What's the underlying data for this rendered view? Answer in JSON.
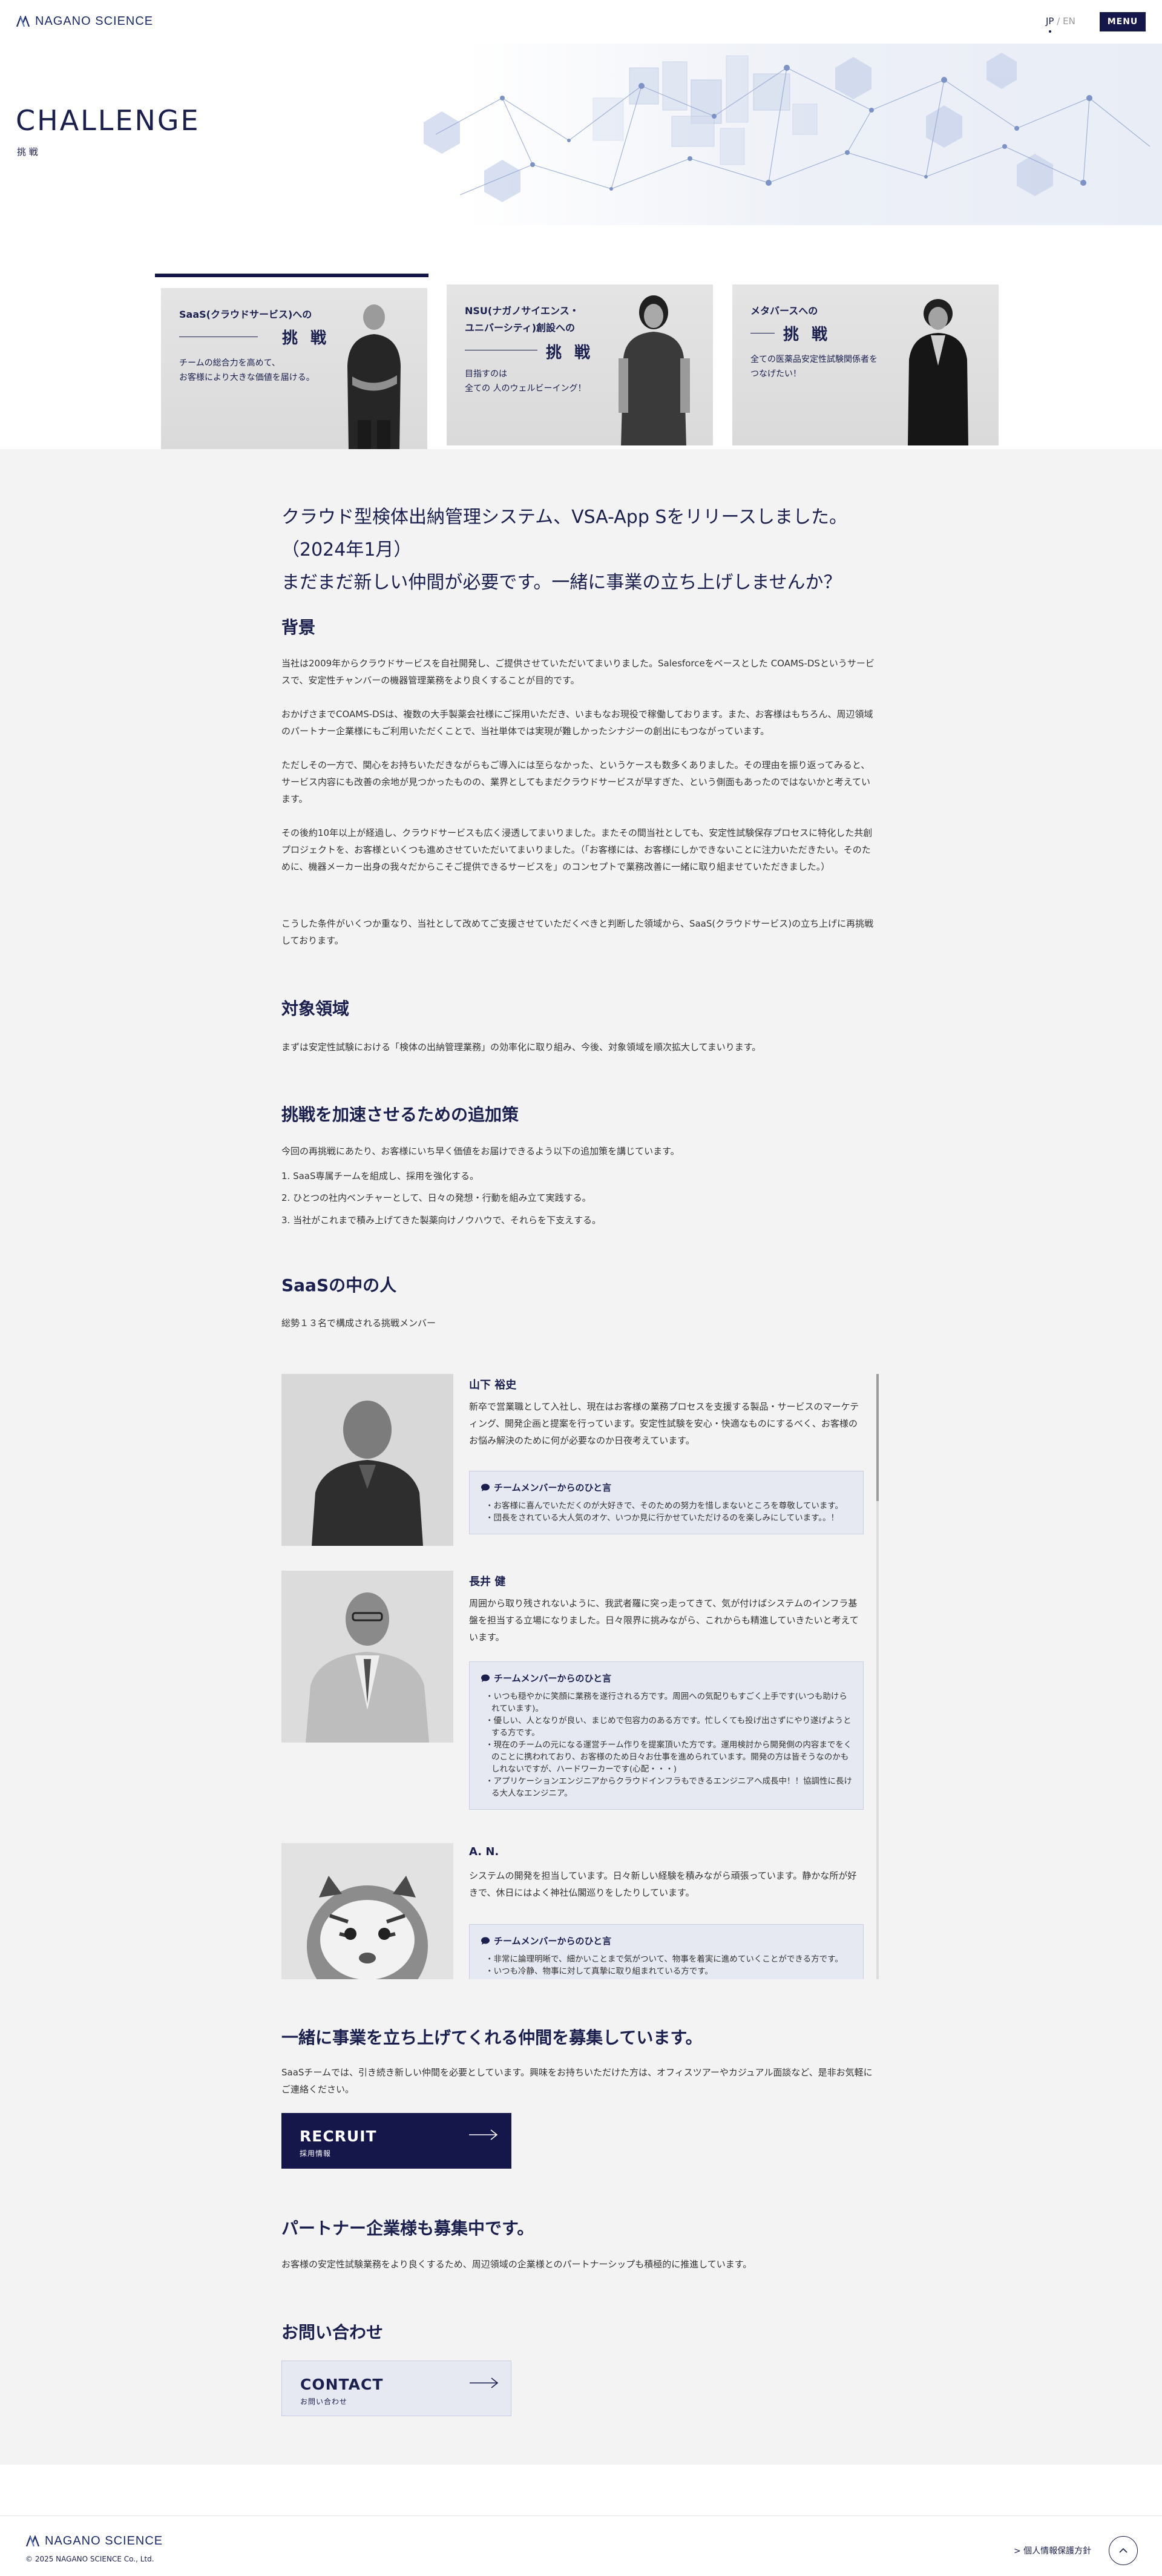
{
  "header": {
    "logo_text": "NAGANO SCIENCE",
    "lang_jp": "JP",
    "lang_sep": "/",
    "lang_en": "EN",
    "menu_label": "MENU"
  },
  "hero": {
    "title": "CHALLENGE",
    "subtitle": "挑 戦"
  },
  "tabs": [
    {
      "title_line1": "SaaS(クラウドサービス)への",
      "title_line2": "",
      "big": "挑 戦",
      "desc_line1": "チームの総合力を高めて、",
      "desc_line2": "お客様により大きな価値を届ける。",
      "active": true
    },
    {
      "title_line1": "NSU(ナガノサイエンス・",
      "title_line2": "ユニバーシティ)創設への",
      "big": "挑 戦",
      "desc_line1": "目指すのは",
      "desc_line2": "全ての 人のウェルビーイング！",
      "active": false
    },
    {
      "title_line1": "メタバースへの",
      "title_line2": "",
      "big": "挑 戦",
      "desc_line1": "全ての医薬品安定性試験関係者を",
      "desc_line2": "つなげたい！",
      "active": false
    }
  ],
  "lead": {
    "line1": "クラウド型検体出納管理システム、VSA-App Sをリリースしました。",
    "line2": "（2024年1月）",
    "line3": "まだまだ新しい仲間が必要です。一緒に事業の立ち上げしませんか？"
  },
  "background": {
    "heading": "背景",
    "p1": "当社は2009年からクラウドサービスを自社開発し、ご提供させていただいてまいりました。Salesforceをベースとした COAMS-DSというサービスで、安定性チャンバーの機器管理業務をより良くすることが目的です。",
    "p2": "おかげさまでCOAMS-DSは、複数の大手製薬会社様にご採用いただき、いまもなお現役で稼働しております。また、お客様はもちろん、周辺領域のパートナー企業様にもご利用いただくことで、当社単体では実現が難しかったシナジーの創出にもつながっています。",
    "p3": "ただしその一方で、関心をお持ちいただきながらもご導入には至らなかった、というケースも数多くありました。その理由を振り返ってみると、サービス内容にも改善の余地が見つかったものの、業界としてもまだクラウドサービスが早すぎた、という側面もあったのではないかと考えています。",
    "p4": "その後約10年以上が経過し、クラウドサービスも広く浸透してまいりました。またその間当社としても、安定性試験保存プロセスに特化した共創プロジェクトを、お客様といくつも進めさせていただいてまいりました。（「お客様には、お客様にしかできないことに注力いただきたい。そのために、機器メーカー出身の我々だからこそご提供できるサービスを」のコンセプトで業務改善に一緒に取り組ませていただきました。）",
    "p5": "こうした条件がいくつか重なり、当社として改めてご支援させていただくべきと判断した領域から、SaaS(クラウドサービス)の立ち上げに再挑戦しております。"
  },
  "target": {
    "heading": "対象領域",
    "p1": "まずは安定性試験における「検体の出納管理業務」の効率化に取り組み、今後、対象領域を順次拡大してまいります。"
  },
  "measures": {
    "heading": "挑戦を加速させるための追加策",
    "intro": "今回の再挑戦にあたり、お客様にいち早く価値をお届けできるよう以下の追加策を講じています。",
    "items": [
      "1. SaaS専属チームを組成し、採用を強化する。",
      "2. ひとつの社内ベンチャーとして、日々の発想・行動を組み立て実践する。",
      "3. 当社がこれまで積み上げてきた製薬向けノウハウで、それらを下支えする。"
    ]
  },
  "people": {
    "heading": "SaaSの中の人",
    "intro": "総勢１３名で構成される挑戦メンバー",
    "comment_title": "チームメンバーからのひと言",
    "members": [
      {
        "name": "山下 裕史",
        "bio": "新卒で営業職として入社し、現在はお客様の業務プロセスを支援する製品・サービスのマーケティング、開発企画と提案を行っています。安定性試験を安心・快適なものにするべく、お客様のお悩み解決のために何が必要なのか日夜考えています。",
        "comments": [
          "・お客様に喜んでいただくのが大好きで、そのための努力を惜しまないところを尊敬しています。",
          "・団長をされている大人気のオケ、いつか見に行かせていただけるのを楽しみにしています。。！"
        ]
      },
      {
        "name": "長井 健",
        "bio": "周囲から取り残されないように、我武者羅に突っ走ってきて、気が付けばシステムのインフラ基盤を担当する立場になりました。日々限界に挑みながら、これからも精進していきたいと考えています。",
        "comments": [
          "・いつも穏やかに笑顔に業務を遂行される方です。周囲への気配りもすごく上手です(いつも助けられています)。",
          "・優しい、人となりが良い、まじめで包容力のある方です。忙しくても投げ出さずにやり遂げようとする方です。",
          "・現在のチームの元になる運営チーム作りを提案頂いた方です。運用検討から開発側の内容までをくのことに携われており、お客様のため日々お仕事を進められています。開発の方は皆そうなのかもしれないですが、ハードワーカーです(心配・・・)",
          "・アプリケーションエンジニアからクラウドインフラもできるエンジニアへ成長中！！協調性に長ける大人なエンジニア。"
        ]
      },
      {
        "name": "A. N.",
        "bio": "システムの開発を担当しています。日々新しい経験を積みながら頑張っています。静かな所が好きで、休日にはよく神社仏閣巡りをしたりしています。",
        "comments": [
          "・非常に論理明晰で、細かいことまで気がついて、物事を着実に進めていくことができる方です。",
          "・いつも冷静、物事に対して真摯に取り組まれている方です。"
        ]
      }
    ]
  },
  "recruit": {
    "heading": "一緒に事業を立ち上げてくれる仲間を募集しています。",
    "p1": "SaaSチームでは、引き続き新しい仲間を必要としています。興味をお持ちいただけた方は、オフィスツアーやカジュアル面談など、是非お気軽にご連絡ください。",
    "button_main": "RECRUIT",
    "button_sub": "採用情報"
  },
  "partner": {
    "heading": "パートナー企業様も募集中です。",
    "p1": "お客様の安定性試験業務をより良くするため、周辺領域の企業様とのパートナーシップも積極的に推進しています。"
  },
  "contact": {
    "heading": "お問い合わせ",
    "button_main": "CONTACT",
    "button_sub": "お問い合わせ"
  },
  "footer": {
    "logo_text": "NAGANO SCIENCE",
    "copyright": "© 2025 NAGANO SCIENCE Co., Ltd.",
    "privacy": "> 個人情報保護方針"
  },
  "colors": {
    "navy": "#15164a",
    "text_navy": "#1a1f4e",
    "gray_bg": "#f3f3f3",
    "box_bg": "#e7e9f2"
  },
  "icons": [
    "logo-mark-icon",
    "chat-bubble-icon",
    "arrow-right-icon",
    "arrow-up-icon"
  ]
}
